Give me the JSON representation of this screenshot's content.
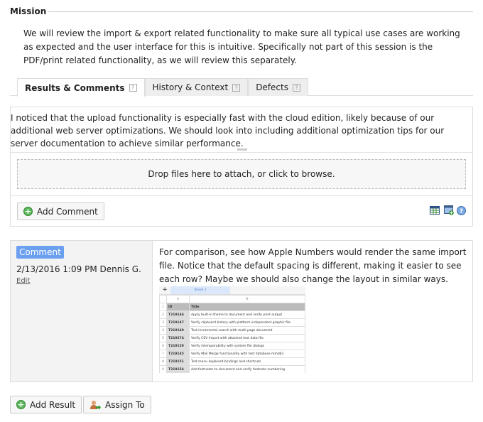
{
  "mission": {
    "heading": "Mission",
    "text": "We will review the import & export related functionality to make sure all typical use cases are working as expected and the user interface for this is intuitive. Specifically not part of this session is the PDF/print related functionality, as we will review this separately."
  },
  "tabs": [
    {
      "label": "Results & Comments",
      "active": true
    },
    {
      "label": "History & Context"
    },
    {
      "label": "Defects"
    }
  ],
  "help_glyph": "?",
  "editor": {
    "text": "I noticed that the upload functionality is especially fast with the cloud edition, likely because of our additional web server optimizations. We should look into including additional optimization tips for our server documentation to achieve similar performance.",
    "dropzone": "Drop files here to attach, or click to browse."
  },
  "add_comment": "Add Comment",
  "toolbar_icons": [
    "table-icon",
    "image-add-icon",
    "help-icon"
  ],
  "comment": {
    "badge": "Comment",
    "badge_color": "#6b9ff0",
    "meta": "2/13/2016 1:09 PM Dennis G.",
    "edit": "Edit",
    "text": "For comparison, see how Apple Numbers would render the same import file. Notice that the default spacing is different, making it easier to see each row? Maybe we should also change the layout in similar ways.",
    "screenshot": {
      "sheet": "Sheet 1",
      "col_a": "A",
      "col_b": "B",
      "header": [
        "ID",
        "Title"
      ],
      "rows": [
        [
          "T219146",
          "Apply built-in theme to document and verify print output"
        ],
        [
          "T219147",
          "Verify clipboard history with platform independent graphic file"
        ],
        [
          "T219149",
          "Test incremental search with multi-page document"
        ],
        [
          "T219274",
          "Verify CSV import with attached test data file"
        ],
        [
          "T219150",
          "Verify interoperability with system file dialogs"
        ],
        [
          "T219145",
          "Verify Mail Merge functionality with test database mmdb1"
        ],
        [
          "T219151",
          "Test menu keyboard bindings and shortcuts"
        ],
        [
          "T219154",
          "Add footnotes to document and verify footnote numbering"
        ]
      ]
    }
  },
  "buttons": {
    "add_result": "Add Result",
    "assign_to": "Assign To"
  }
}
